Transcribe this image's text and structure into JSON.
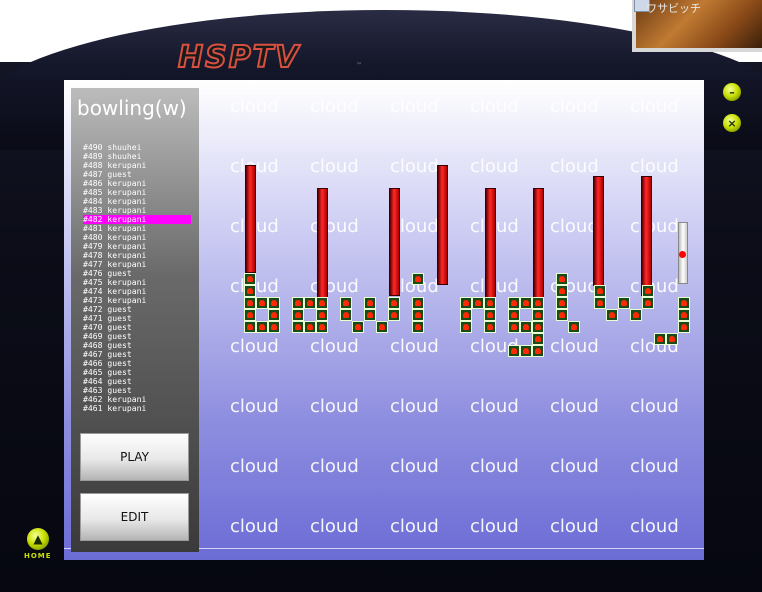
{
  "app": {
    "logo": "HSPTV",
    "logo_tm": "™",
    "home_label": "HOME",
    "corner_text": "ワサビッチ"
  },
  "game": {
    "title": "bowling(w)",
    "background_word": "cloud",
    "scores": [
      "#490 shuuhei",
      "#489 shuuhei",
      "#488 kerupani",
      "#487 guest",
      "#486 kerupani",
      "#485 kerupani",
      "#484 kerupani",
      "#483 kerupani",
      "#482 kerupani",
      "#481 kerupani",
      "#480 kerupani",
      "#479 kerupani",
      "#478 kerupani",
      "#477 kerupani",
      "#476 guest",
      "#475 kerupani",
      "#474 kerupani",
      "#473 kerupani",
      "#472 guest",
      "#471 guest",
      "#470 guest",
      "#469 guest",
      "#468 guest",
      "#467 guest",
      "#466 guest",
      "#465 guest",
      "#464 guest",
      "#463 guest",
      "#462 kerupani",
      "#461 kerupani"
    ],
    "selected_score_index": 8,
    "play_label": "PLAY",
    "edit_label": "EDIT"
  },
  "colors": {
    "selection": "#ff00ff",
    "accent": "#c8e000",
    "bar": "#ff2a2a",
    "pin": "#ff2a00"
  },
  "icons": [
    "minimize-icon",
    "close-icon",
    "home-icon"
  ]
}
